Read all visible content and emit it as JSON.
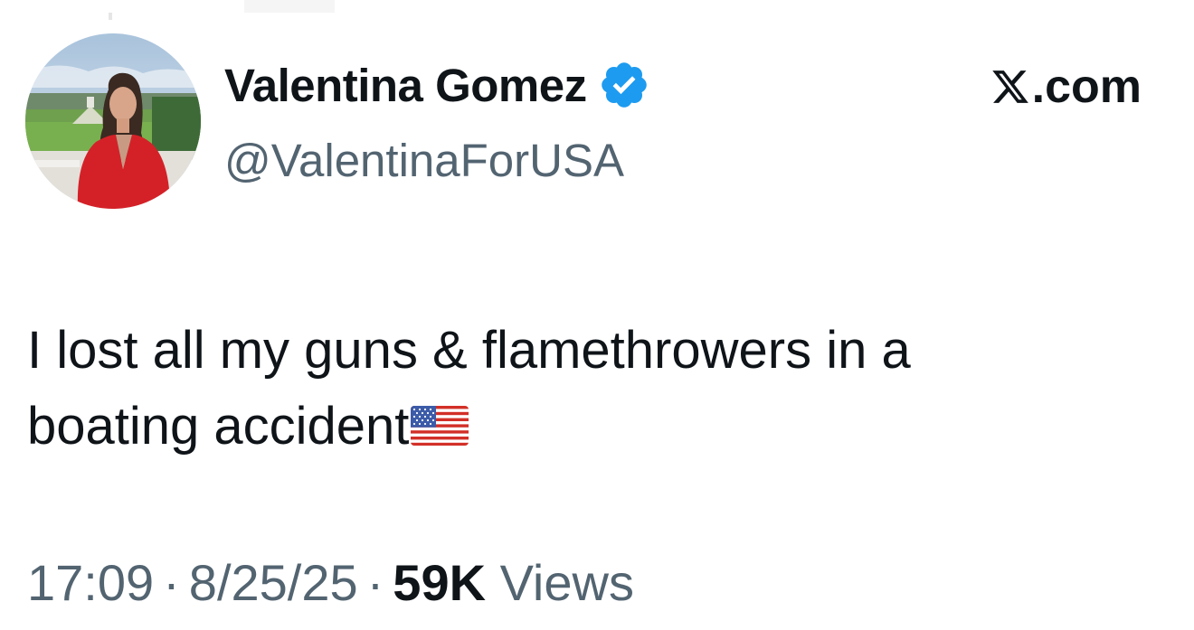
{
  "author": {
    "display_name": "Valentina Gomez",
    "handle": "@ValentinaForUSA",
    "verified": true,
    "avatar": "profile-photo-woman-red-jacket"
  },
  "site": {
    "label": ".com",
    "logo": "x-logo-icon"
  },
  "tweet": {
    "lines": [
      "I lost all my guns & flamethrowers in a",
      "boating accident"
    ],
    "emoji": "us-flag-icon"
  },
  "meta": {
    "time": "17:09",
    "separator": "·",
    "date": "8/25/25",
    "views_count": "59K",
    "views_label": "Views"
  },
  "colors": {
    "text_primary": "#0f1419",
    "text_secondary": "#536471",
    "verified_blue": "#1d9bf0",
    "background": "#ffffff"
  }
}
